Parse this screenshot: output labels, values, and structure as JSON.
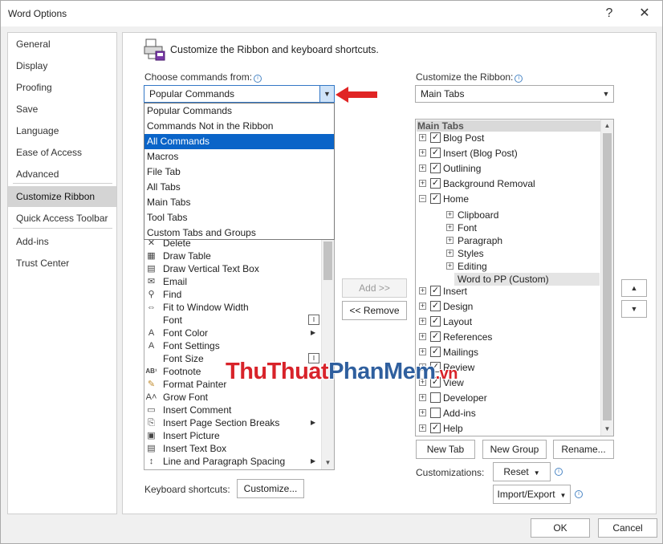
{
  "window": {
    "title": "Word Options",
    "help_glyph": "?",
    "close_glyph": "✕"
  },
  "nav": {
    "items": [
      {
        "label": "General"
      },
      {
        "label": "Display"
      },
      {
        "label": "Proofing"
      },
      {
        "label": "Save"
      },
      {
        "label": "Language"
      },
      {
        "label": "Ease of Access"
      },
      {
        "label": "Advanced"
      },
      {
        "label": "Customize Ribbon",
        "active": true
      },
      {
        "label": "Quick Access Toolbar"
      },
      {
        "label": "Add-ins"
      },
      {
        "label": "Trust Center"
      }
    ]
  },
  "main": {
    "heading": "Customize the Ribbon and keyboard shortcuts.",
    "choose_label": "Choose commands from:",
    "choose_value": "Popular Commands",
    "choose_options": [
      "Popular Commands",
      "Commands Not in the Ribbon",
      "All Commands",
      "Macros",
      "File Tab",
      "All Tabs",
      "Main Tabs",
      "Tool Tabs",
      "Custom Tabs and Groups"
    ],
    "choose_selected": "All Commands",
    "commands": [
      {
        "label": "Delete",
        "icon": "delete-icon",
        "glyph": "✕"
      },
      {
        "label": "Draw Table",
        "icon": "draw-table-icon",
        "glyph": "▦"
      },
      {
        "label": "Draw Vertical Text Box",
        "icon": "text-box-icon",
        "glyph": "▤"
      },
      {
        "label": "Email",
        "icon": "email-icon",
        "glyph": "✉"
      },
      {
        "label": "Find",
        "icon": "find-icon",
        "glyph": "⚲"
      },
      {
        "label": "Fit to Window Width",
        "icon": "fit-width-icon",
        "glyph": "⇔"
      },
      {
        "label": "Font",
        "icon": "",
        "glyph": "",
        "size_box": "I"
      },
      {
        "label": "Font Color",
        "icon": "font-color-icon",
        "glyph": "A",
        "submenu": true
      },
      {
        "label": "Font Settings",
        "icon": "font-settings-icon",
        "glyph": "A"
      },
      {
        "label": "Font Size",
        "icon": "",
        "glyph": "",
        "size_box": "I"
      },
      {
        "label": "Footnote",
        "icon": "footnote-icon",
        "glyph": "AB¹"
      },
      {
        "label": "Format Painter",
        "icon": "format-painter-icon",
        "glyph": "✎"
      },
      {
        "label": "Grow Font",
        "icon": "grow-font-icon",
        "glyph": "A˄"
      },
      {
        "label": "Insert Comment",
        "icon": "comment-icon",
        "glyph": "▭"
      },
      {
        "label": "Insert Page  Section Breaks",
        "icon": "page-break-icon",
        "glyph": "⎘",
        "submenu": true
      },
      {
        "label": "Insert Picture",
        "icon": "picture-icon",
        "glyph": "▣"
      },
      {
        "label": "Insert Text Box",
        "icon": "text-box-icon",
        "glyph": "▤"
      },
      {
        "label": "Line and Paragraph Spacing",
        "icon": "line-spacing-icon",
        "glyph": "↕",
        "submenu": true
      }
    ],
    "add_button": "Add >>",
    "remove_button": "<< Remove",
    "keyboard_label": "Keyboard shortcuts:",
    "customize_button": "Customize..."
  },
  "ribbon": {
    "label": "Customize the Ribbon:",
    "value": "Main Tabs",
    "tree_header": "Main Tabs",
    "nodes": [
      {
        "label": "Blog Post",
        "level": 0,
        "expand": "+",
        "checked": true
      },
      {
        "label": "Insert (Blog Post)",
        "level": 0,
        "expand": "+",
        "checked": true
      },
      {
        "label": "Outlining",
        "level": 0,
        "expand": "+",
        "checked": true
      },
      {
        "label": "Background Removal",
        "level": 0,
        "expand": "+",
        "checked": true
      },
      {
        "label": "Home",
        "level": 0,
        "expand": "−",
        "checked": true
      },
      {
        "label": "Clipboard",
        "level": 1,
        "expand": "+"
      },
      {
        "label": "Font",
        "level": 1,
        "expand": "+"
      },
      {
        "label": "Paragraph",
        "level": 1,
        "expand": "+"
      },
      {
        "label": "Styles",
        "level": 1,
        "expand": "+"
      },
      {
        "label": "Editing",
        "level": 1,
        "expand": "+"
      },
      {
        "label": "Word to PP (Custom)",
        "level": 2,
        "highlight": true
      },
      {
        "label": "Insert",
        "level": 0,
        "expand": "+",
        "checked": true
      },
      {
        "label": "Design",
        "level": 0,
        "expand": "+",
        "checked": true
      },
      {
        "label": "Layout",
        "level": 0,
        "expand": "+",
        "checked": true
      },
      {
        "label": "References",
        "level": 0,
        "expand": "+",
        "checked": true
      },
      {
        "label": "Mailings",
        "level": 0,
        "expand": "+",
        "checked": true
      },
      {
        "label": "Review",
        "level": 0,
        "expand": "+",
        "checked": true
      },
      {
        "label": "View",
        "level": 0,
        "expand": "+",
        "checked": true
      },
      {
        "label": "Developer",
        "level": 0,
        "expand": "+",
        "checked": false
      },
      {
        "label": "Add-ins",
        "level": 0,
        "expand": "+",
        "checked": false
      },
      {
        "label": "Help",
        "level": 0,
        "expand": "+",
        "checked": true
      }
    ],
    "new_tab": "New Tab",
    "new_group": "New Group",
    "rename": "Rename...",
    "customizations_label": "Customizations:",
    "reset": "Reset",
    "import_export": "Import/Export"
  },
  "footer": {
    "ok": "OK",
    "cancel": "Cancel"
  },
  "watermark": {
    "part1": "ThuThuat",
    "part2": "PhanMem",
    "part3": ".vn"
  },
  "colors": {
    "selection": "#0a64c8",
    "annotation_arrow": "#e02424"
  }
}
